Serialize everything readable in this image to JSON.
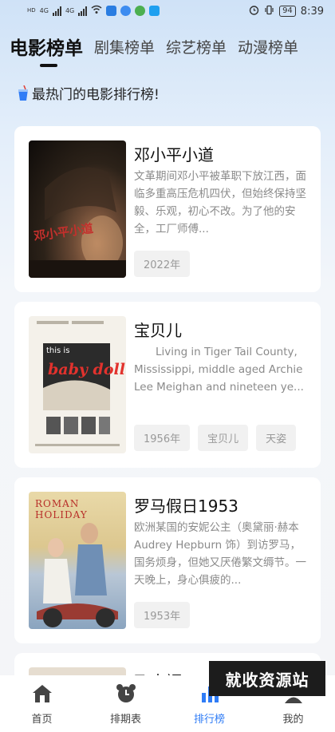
{
  "status_bar": {
    "left_labels": [
      "HD",
      "4G",
      "HD",
      "4G"
    ],
    "time": "8:39",
    "battery": "94"
  },
  "tabs": [
    {
      "label": "电影榜单",
      "active": true
    },
    {
      "label": "剧集榜单",
      "active": false
    },
    {
      "label": "综艺榜单",
      "active": false
    },
    {
      "label": "动漫榜单",
      "active": false
    }
  ],
  "headline": {
    "icon": "drink-cup-icon",
    "text": "最热门的电影排行榜!"
  },
  "movies": [
    {
      "title": "邓小平小道",
      "description": "文革期间邓小平被革职下放江西，面临多重高压危机四伏，但始终保持坚毅、乐观，初心不改。为了他的安全，工厂师傅...",
      "tags": [
        "2022年"
      ],
      "poster_text": "邓小平小道"
    },
    {
      "title": "宝贝儿",
      "description": "　　Living in Tiger Tail County, Mississippi, middle aged Archie Lee Meighan and nineteen ye...",
      "tags": [
        "1956年",
        "宝贝儿",
        "天姿"
      ],
      "poster_text": "baby doll"
    },
    {
      "title": "罗马假日1953",
      "description": "欧洲某国的安妮公主（奥黛丽·赫本 Audrey Hepburn 饰）到访罗马，国务烦身，但她又厌倦繁文缛节。一天晚上，身心俱疲的...",
      "tags": [
        "1953年"
      ],
      "poster_text": "ROMAN HOLIDAY"
    },
    {
      "title": "飞来福",
      "description": "",
      "tags": [],
      "poster_text": ""
    }
  ],
  "bottom_nav": [
    {
      "label": "首页",
      "icon": "home-icon",
      "active": false
    },
    {
      "label": "排期表",
      "icon": "alarm-clock-icon",
      "active": false
    },
    {
      "label": "排行榜",
      "icon": "bar-chart-icon",
      "active": true
    },
    {
      "label": "我的",
      "icon": "profile-icon",
      "active": false
    }
  ],
  "watermark": "就收资源站",
  "colors": {
    "accent": "#2f7cf6"
  }
}
